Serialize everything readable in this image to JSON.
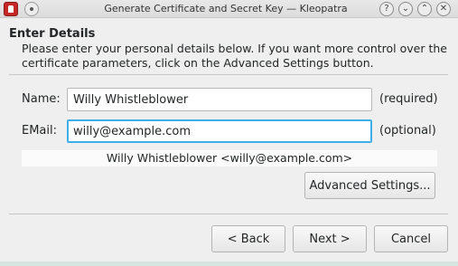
{
  "window": {
    "title": "Generate Certificate and Secret Key — Kleopatra",
    "help_glyph": "?",
    "minimize_glyph": "⌄",
    "maximize_glyph": "⌃",
    "close_glyph": "✕"
  },
  "page": {
    "heading": "Enter Details",
    "intro": "Please enter your personal details below. If you want more control over the certificate parameters, click on the Advanced Settings button."
  },
  "form": {
    "name_label": "Name:",
    "name_value": "Willy Whistleblower",
    "name_hint": "(required)",
    "email_label": "EMail:",
    "email_value": "willy@example.com",
    "email_hint": "(optional)",
    "preview": "Willy Whistleblower <willy@example.com>"
  },
  "buttons": {
    "advanced": "Advanced Settings...",
    "back": "< Back",
    "next": "Next >",
    "cancel": "Cancel"
  },
  "colors": {
    "focus_accent": "#3daee9",
    "app_icon": "#c62828"
  }
}
